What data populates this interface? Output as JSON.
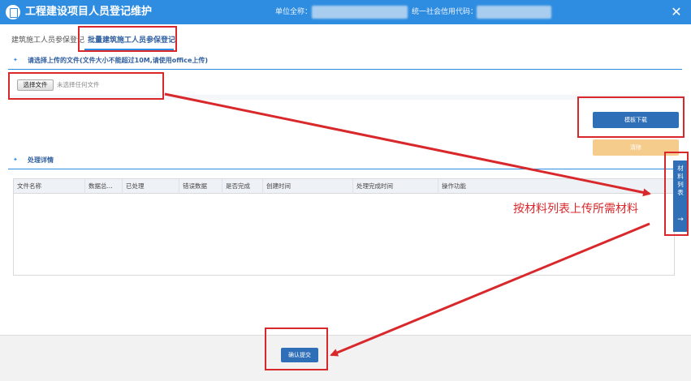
{
  "window": {
    "title": "工程建设项目人员登记维护",
    "unit_name_label": "单位全称：",
    "credit_code_label": "统一社会信用代码："
  },
  "tabs": [
    {
      "label": "建筑施工人员参保登记"
    },
    {
      "label": "批量建筑施工人员参保登记"
    }
  ],
  "upload": {
    "section_title": "请选择上传的文件(文件大小不能超过10M,请使用office上传)",
    "choose_file_label": "选择文件",
    "file_status": "未选择任何文件",
    "template_download_label": "模板下载",
    "clear_label": "清除"
  },
  "details": {
    "section_title": "处理详情",
    "columns": [
      "文件名称",
      "数据总...",
      "已处理",
      "错误数据",
      "是否完成",
      "创建时间",
      "处理完成时间",
      "操作功能"
    ]
  },
  "side_tab": {
    "label": "材料列表",
    "arrow": "→"
  },
  "annotation": "按材料列表上传所需材料",
  "footer": {
    "submit_label": "确认提交"
  },
  "colors": {
    "titlebar": "#2f8de1",
    "primary": "#2f6fb8",
    "warning": "#f6cc8c",
    "annotation": "#d9282b"
  }
}
